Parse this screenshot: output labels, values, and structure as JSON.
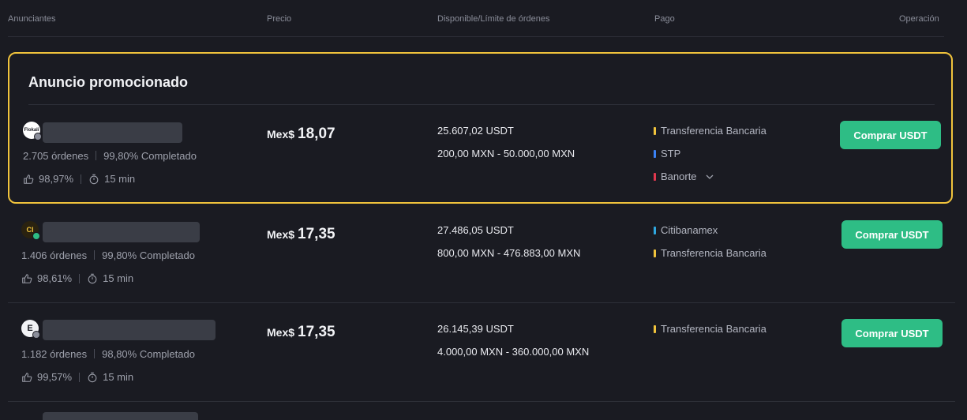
{
  "header": {
    "advertisers": "Anunciantes",
    "price": "Precio",
    "available": "Disponible/Límite de órdenes",
    "payment": "Pago",
    "operation": "Operación"
  },
  "promo": {
    "title": "Anuncio promocionado"
  },
  "colors": {
    "accent_green": "#2ebd85",
    "promo_border": "#f0c33c",
    "bar_yellow": "#f0c33c",
    "bar_blue": "#3b82f6",
    "bar_red": "#e0384e",
    "bar_cyan": "#2fa8e0"
  },
  "ads": [
    {
      "avatar_text": "Flokali",
      "orders": "2.705 órdenes",
      "completion": "99,80% Completado",
      "rating": "98,97%",
      "time": "15 min",
      "currency": "Mex$",
      "price": "18,07",
      "available": "25.607,02 USDT",
      "limits": "200,00 MXN - 50.000,00 MXN",
      "payments": [
        "Transferencia Bancaria",
        "STP",
        "Banorte"
      ],
      "button": "Comprar USDT"
    },
    {
      "avatar_text": "CI",
      "orders": "1.406 órdenes",
      "completion": "99,80% Completado",
      "rating": "98,61%",
      "time": "15 min",
      "currency": "Mex$",
      "price": "17,35",
      "available": "27.486,05 USDT",
      "limits": "800,00 MXN - 476.883,00 MXN",
      "payments": [
        "Citibanamex",
        "Transferencia Bancaria"
      ],
      "button": "Comprar USDT"
    },
    {
      "avatar_text": "E",
      "orders": "1.182 órdenes",
      "completion": "98,80% Completado",
      "rating": "99,57%",
      "time": "15 min",
      "currency": "Mex$",
      "price": "17,35",
      "available": "26.145,39 USDT",
      "limits": "4.000,00 MXN - 360.000,00 MXN",
      "payments": [
        "Transferencia Bancaria"
      ],
      "button": "Comprar USDT"
    }
  ]
}
